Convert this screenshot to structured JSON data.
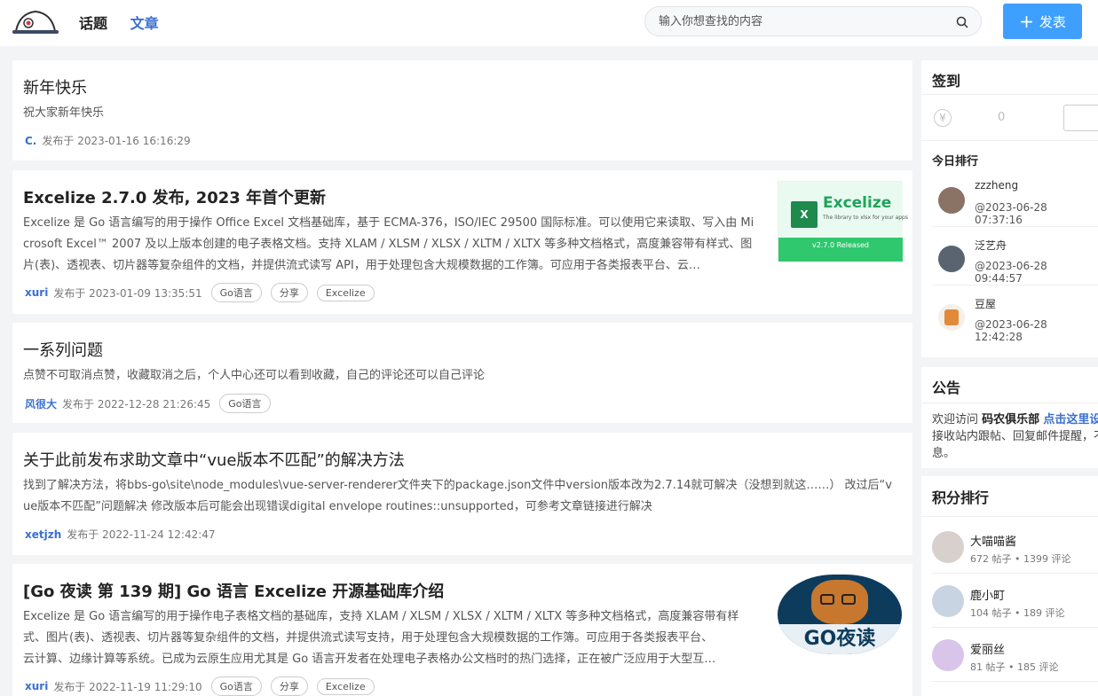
{
  "header": {
    "nav": [
      "话题",
      "文章"
    ],
    "search_placeholder": "输入你想查找的内容",
    "post_button": "发表",
    "post_plus": "+"
  },
  "articles": [
    {
      "title": "新年快乐",
      "summary": "祝大家新年快乐",
      "author": "C.",
      "date": "发布于 2023-01-16 16:16:29",
      "tags": []
    },
    {
      "title": "Excelize 2.7.0 发布, 2023 年首个更新",
      "summary_lines": [
        "Excelize 是 Go 语言编写的用于操作 Office Excel 文档基础库，基于 ECMA-376，ISO/IEC 29500 国际标准。可以使用它来读取、写入由 Mi",
        "crosoft Excel™ 2007 及以上版本创建的电子表格文档。支持 XLAM / XLSM / XLSX / XLTM / XLTX 等多种文档格式，高度兼容带有样式、图",
        "片(表)、透视表、切片器等复杂组件的文档，并提供流式读写 API，用于处理包含大规模数据的工作簿。可应用于各类报表平台、云…"
      ],
      "author": "xuri",
      "date": "发布于 2023-01-09 13:35:51",
      "tags": [
        "Go语言",
        "分享",
        "Excelize"
      ],
      "thumb": {
        "title": "Excelize",
        "subtitle": "The library to xlsx for your apps",
        "release": "v2.7.0 Released"
      }
    },
    {
      "title": "一系列问题",
      "summary": "点赞不可取消点赞，收藏取消之后，个人中心还可以看到收藏，自己的评论还可以自己评论",
      "author": "风很大",
      "date": "发布于 2022-12-28 21:26:45",
      "tags": [
        "Go语言"
      ]
    },
    {
      "title": "关于此前发布求助文章中“vue版本不匹配”的解决方法",
      "summary_lines": [
        "找到了解决方法，将bbs-go\\site\\node_modules\\vue-server-renderer文件夹下的package.json文件中version版本改为2.7.14就可解决（没想到就这……） 改过后“v",
        "ue版本不匹配”问题解决 修改版本后可能会出现错误digital envelope routines::unsupported，可参考文章链接进行解决"
      ],
      "author": "xetjzh",
      "date": "发布于 2022-11-24 12:42:47",
      "tags": []
    },
    {
      "title": "[Go 夜读 第 139 期] Go 语言 Excelize 开源基础库介绍",
      "summary_lines": [
        "Excelize 是 Go 语言编写的用于操作电子表格文档的基础库，支持 XLAM / XLSM / XLSX / XLTM / XLTX 等多种文档格式，高度兼容带有样",
        "式、图片(表)、透视表、切片器等复杂组件的文档，并提供流式读写支持，用于处理包含大规模数据的工作簿。可应用于各类报表平台、",
        "云计算、边缘计算等系统。已成为云原生应用尤其是 Go 语言开发者在处理电子表格办公文档时的热门选择，正在被广泛应用于大型互…"
      ],
      "author": "xuri",
      "date": "发布于 2022-11-19 11:29:10",
      "tags": [
        "Go语言",
        "分享",
        "Excelize"
      ],
      "thumb": {
        "title": "GO夜读"
      }
    }
  ],
  "sidebar": {
    "checkin": {
      "title": "签到",
      "coin_symbol": "¥",
      "coin_value": "0",
      "today_rank_title": "今日排行",
      "users": [
        {
          "name": "zzzheng",
          "time": "@2023-06-28 07:37:16"
        },
        {
          "name": "泛艺舟",
          "time": "@2023-06-28 09:44:57"
        },
        {
          "name": "豆屋",
          "time": "@2023-06-28 12:42:28"
        }
      ]
    },
    "notice": {
      "title": "公告",
      "text_prefix": "欢迎访问",
      "site_name": "码农俱乐部",
      "link": "点击这里设",
      "text_suffix": "接收站内跟帖、回复邮件提醒，不",
      "text_end": "息。"
    },
    "score_rank": {
      "title": "积分排行",
      "users": [
        {
          "name": "大喵喵酱",
          "stats": "672 帖子 • 1399 评论"
        },
        {
          "name": "鹿小町",
          "stats": "104 帖子 • 189 评论"
        },
        {
          "name": "爱丽丝",
          "stats": "81 帖子 • 185 评论"
        }
      ]
    }
  }
}
